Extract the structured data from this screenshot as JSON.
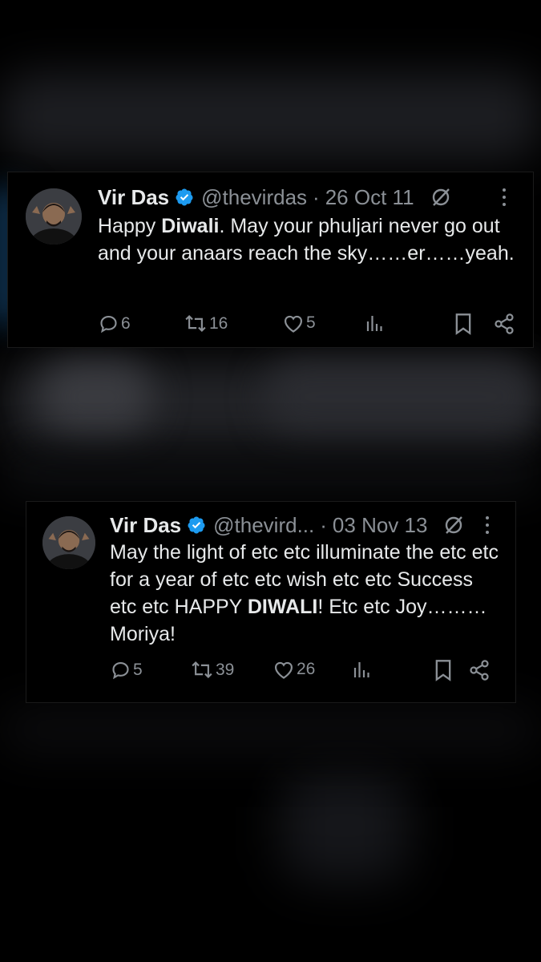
{
  "tweets": [
    {
      "name": "Vir Das",
      "handle": "@thevirdas",
      "separator": "·",
      "date": "26 Oct 11",
      "text": {
        "pre": "Happy ",
        "bold": "Diwali",
        "post_line1": ". May your phuljari never go out and your anaars reach the sky……er……yeah."
      },
      "replies": "6",
      "reposts": "16",
      "likes": "5"
    },
    {
      "name": "Vir Das",
      "handle": "@thevird...",
      "separator": "·",
      "date": "03 Nov 13",
      "text": {
        "pre": "May the light of etc etc illuminate the etc etc for a year of etc etc wish etc etc Success etc etc HAPPY ",
        "bold": "DIWALI",
        "post_line1": "! Etc etc Joy………Moriya!"
      },
      "replies": "5",
      "reposts": "39",
      "likes": "26"
    }
  ],
  "icons": {
    "verified": "verified-badge-icon",
    "grok": "grok-icon",
    "more": "more-icon",
    "reply": "reply-icon",
    "repost": "repost-icon",
    "like": "like-icon",
    "views": "views-icon",
    "bookmark": "bookmark-icon",
    "share": "share-icon"
  },
  "colors": {
    "background": "#000000",
    "text": "#e7e9ea",
    "muted": "#8b9096",
    "verified": "#1d9bf0"
  }
}
